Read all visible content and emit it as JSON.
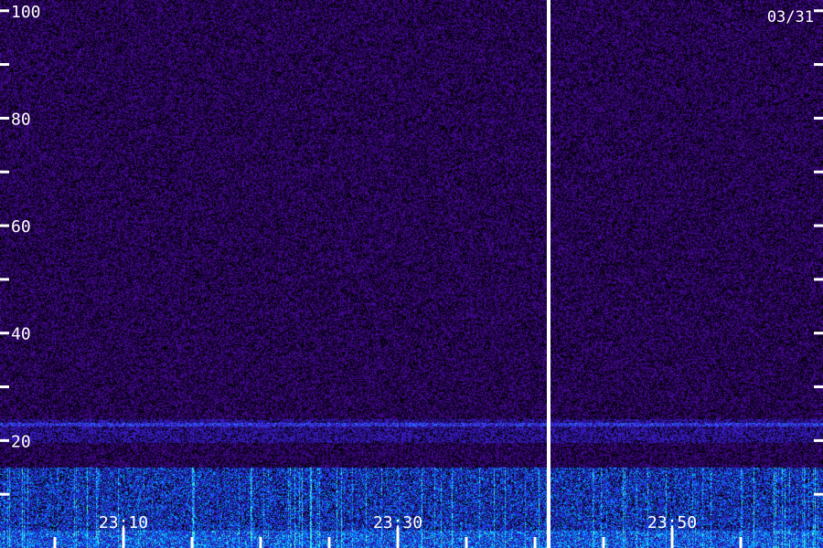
{
  "chart_data": {
    "type": "heatmap",
    "title": "",
    "xlabel": "",
    "ylabel": "",
    "date_label": "03/31",
    "y_ticks": [
      100,
      80,
      60,
      40,
      20
    ],
    "y_minor_ticks": [
      10,
      30,
      50,
      70,
      90
    ],
    "ylim": [
      0,
      102
    ],
    "x_ticks": [
      "23:10",
      "23:30",
      "23:50"
    ],
    "x_range": [
      "23:01",
      "23:61"
    ],
    "x_tick_minutes": [
      10,
      30,
      50
    ],
    "x_minor_tick_minutes": [
      0,
      5,
      15,
      20,
      25,
      35,
      40,
      45,
      55
    ],
    "data_gap_minute": 41,
    "grid": false,
    "colormap": [
      "#000000",
      "#2a0055",
      "#4a10a0",
      "#2a3cff",
      "#00d8ff",
      "#80ffd0"
    ],
    "bands": [
      {
        "name": "",
        "y_from": 0,
        "y_to": 15,
        "level": "high"
      },
      {
        "name": "",
        "y_from": 21,
        "y_to": 24,
        "level": "medium"
      },
      {
        "name": "",
        "y_from": 24,
        "y_to": 102,
        "level": "low"
      }
    ]
  }
}
